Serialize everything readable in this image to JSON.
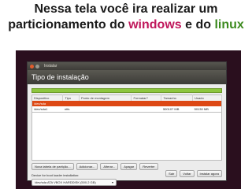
{
  "caption": {
    "line1": "Nessa tela você ira realizar um",
    "line2_pre": "particionamento do ",
    "line2_windows": "windows",
    "line2_mid": " e do ",
    "line2_linux": "linux"
  },
  "window": {
    "title": "Instalar",
    "heading": "Tipo de instalação"
  },
  "table": {
    "headers": [
      "Dispositivo",
      "Tipo",
      "Ponto de montagem",
      "Formatar?",
      "Tamanho",
      "Usado"
    ],
    "rows": [
      [
        "/dev/sda",
        "",
        "",
        "",
        "",
        ""
      ],
      [
        "/dev/sda1",
        "ntfs",
        "",
        "",
        "500107 MB",
        "50130 MB"
      ]
    ]
  },
  "buttons": {
    "new_table": "Nova tabela de partição...",
    "add": "Adicionar...",
    "change": "Alterar...",
    "delete": "Apagar",
    "revert": "Reverter"
  },
  "bootloader": {
    "label": "Device for boot loader installation:",
    "value": "/dev/sda  ATA VBOX HARDDISK (500.2 GB)"
  },
  "footer": {
    "quit": "Sair",
    "back": "Voltar",
    "install": "Instalar agora"
  }
}
